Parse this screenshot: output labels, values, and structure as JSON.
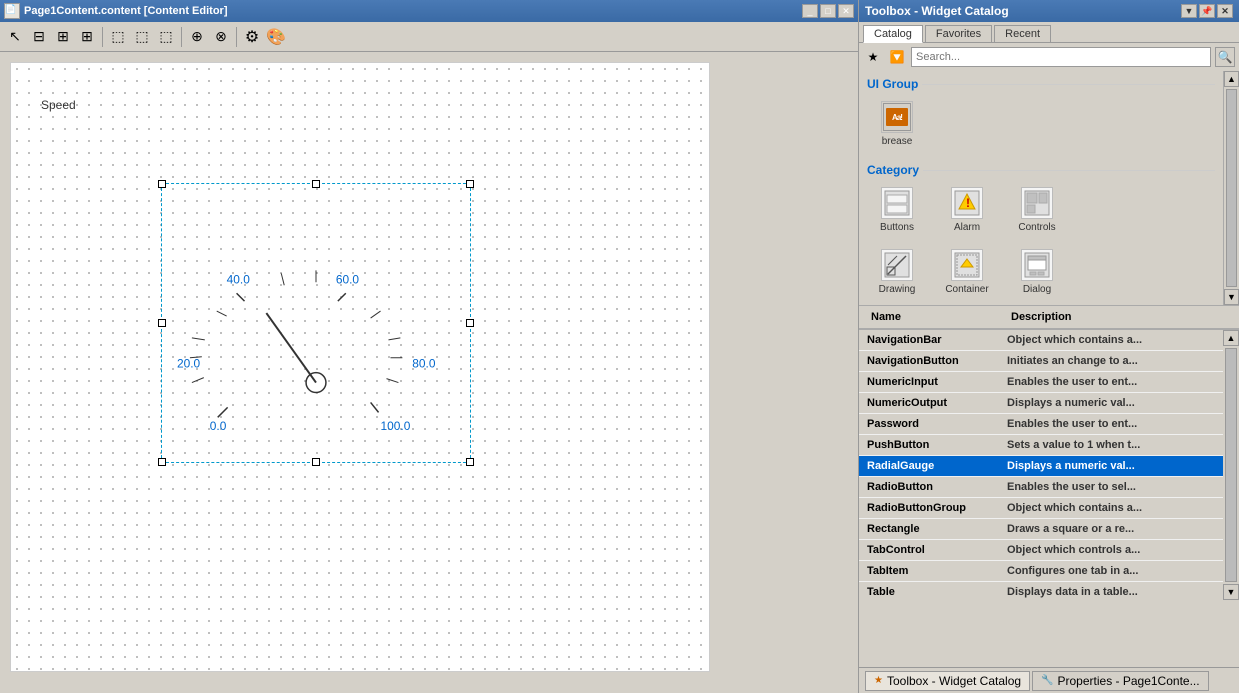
{
  "contentEditor": {
    "title": "Page1Content.content [Content Editor]",
    "toolbar": {
      "tools": [
        "select",
        "move",
        "resize",
        "insert",
        "align-left",
        "align-center",
        "align-right",
        "group",
        "ungroup",
        "settings",
        "color-picker"
      ]
    }
  },
  "canvas": {
    "speedLabel": "Speed",
    "gaugeValues": {
      "v0": "0.0",
      "v20": "20.0",
      "v40": "40.0",
      "v60": "60.0",
      "v80": "80.0",
      "v100": "100.0"
    }
  },
  "toolbox": {
    "title": "Toolbox - Widget Catalog",
    "tabs": [
      "Catalog",
      "Favorites",
      "Recent"
    ],
    "activeTab": "Catalog",
    "search": {
      "placeholder": "Search..."
    },
    "uiGroup": {
      "title": "UI Group",
      "items": [
        {
          "id": "brease",
          "label": "brease",
          "iconType": "brease"
        }
      ]
    },
    "category": {
      "title": "Category",
      "items": [
        {
          "id": "buttons",
          "label": "Buttons",
          "iconType": "buttons"
        },
        {
          "id": "alarm",
          "label": "Alarm",
          "iconType": "alarm"
        },
        {
          "id": "controls",
          "label": "Controls",
          "iconType": "controls"
        },
        {
          "id": "drawing",
          "label": "Drawing",
          "iconType": "drawing"
        },
        {
          "id": "container",
          "label": "Container",
          "iconType": "container"
        },
        {
          "id": "dialog",
          "label": "Dialog",
          "iconType": "dialog"
        }
      ]
    },
    "list": {
      "headers": [
        "Name",
        "Description"
      ],
      "items": [
        {
          "name": "NavigationBar",
          "desc": "Object which contains a...",
          "selected": false
        },
        {
          "name": "NavigationButton",
          "desc": "Initiates an change to a...",
          "selected": false
        },
        {
          "name": "NumericInput",
          "desc": "Enables the user to ent...",
          "selected": false
        },
        {
          "name": "NumericOutput",
          "desc": "Displays a numeric val...",
          "selected": false
        },
        {
          "name": "Password",
          "desc": "Enables the user to ent...",
          "selected": false
        },
        {
          "name": "PushButton",
          "desc": "Sets a value to 1 when t...",
          "selected": false
        },
        {
          "name": "RadialGauge",
          "desc": "Displays a numeric val...",
          "selected": true
        },
        {
          "name": "RadioButton",
          "desc": "Enables the user to sel...",
          "selected": false
        },
        {
          "name": "RadioButtonGroup",
          "desc": "Object which contains a...",
          "selected": false
        },
        {
          "name": "Rectangle",
          "desc": "Draws a square or a re...",
          "selected": false
        },
        {
          "name": "TabControl",
          "desc": "Object which controls a...",
          "selected": false
        },
        {
          "name": "TabItem",
          "desc": "Configures one tab in a...",
          "selected": false
        },
        {
          "name": "Table",
          "desc": "Displays data in a table...",
          "selected": false
        }
      ]
    },
    "bottomTabs": [
      {
        "id": "toolbox-widget-catalog",
        "label": "Toolbox - Widget Catalog",
        "active": true
      },
      {
        "id": "properties-page1content",
        "label": "Properties - Page1Conte...",
        "active": false
      }
    ]
  }
}
